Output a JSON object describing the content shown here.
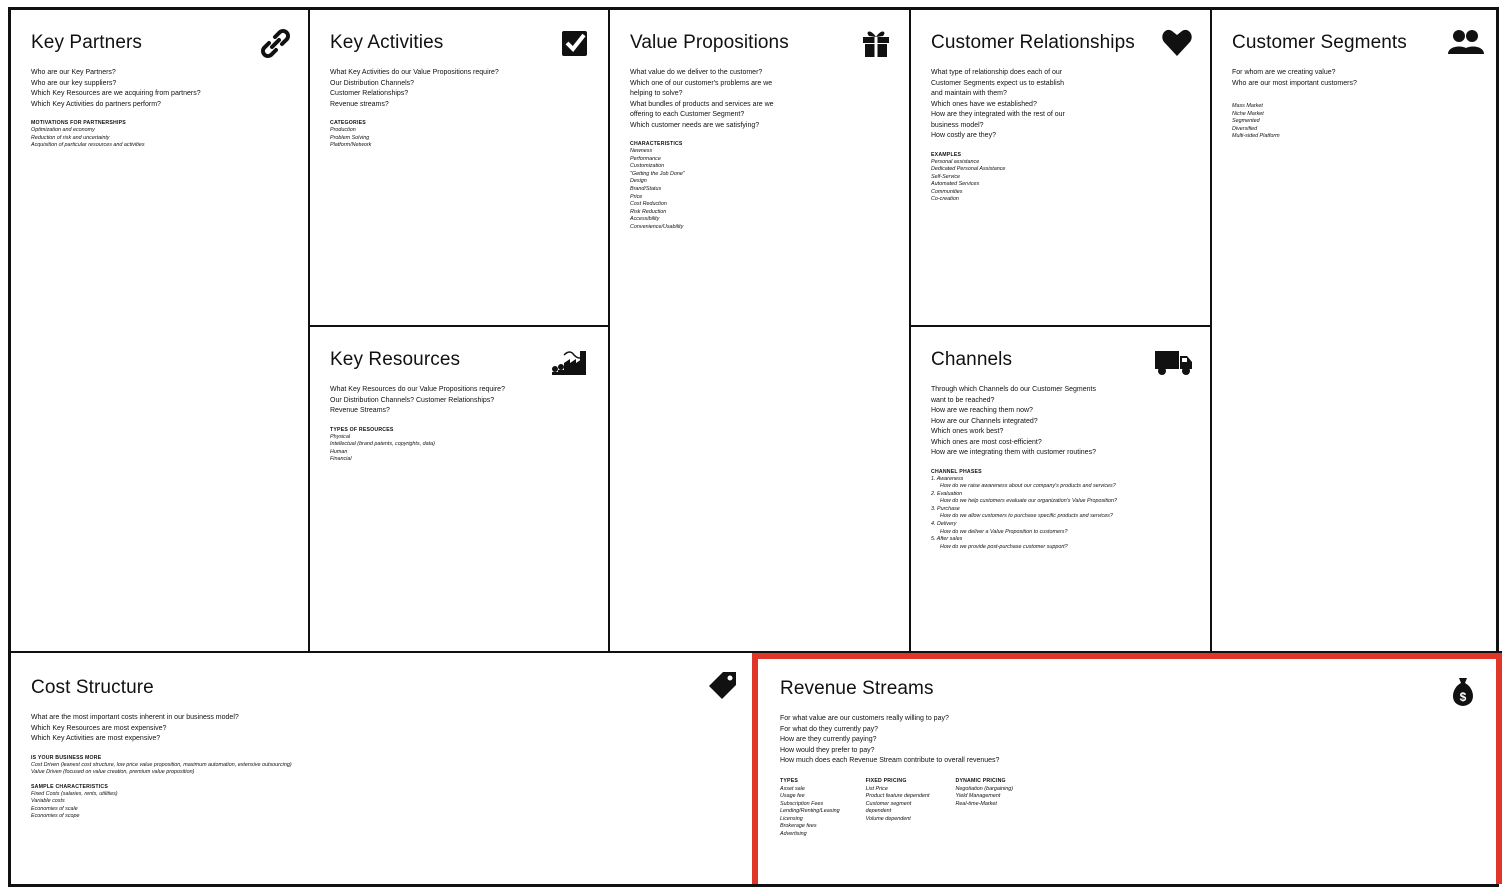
{
  "accent_color": "#e0362a",
  "cells": {
    "key_partners": {
      "title": "Key Partners",
      "icon": "link-icon",
      "questions": [
        "Who are our Key Partners?",
        "Who are our key suppliers?",
        "Which Key Resources are we acquiring from partners?",
        "Which Key Activities do partners perform?"
      ],
      "section_heading": "MOTIVATIONS FOR PARTNERSHIPS",
      "section_items": [
        "Optimization and economy",
        "Reduction of risk and uncertainty",
        "Acquisition of particular resources and activities"
      ]
    },
    "key_activities": {
      "title": "Key Activities",
      "icon": "checkbox-icon",
      "questions": [
        "What Key Activities do our Value Propositions require?",
        "Our Distribution Channels?",
        "Customer Relationships?",
        "Revenue streams?"
      ],
      "section_heading": "CATEGORIES",
      "section_items": [
        "Production",
        "Problem Solving",
        "Platform/Network"
      ]
    },
    "key_resources": {
      "title": "Key Resources",
      "icon": "factory-icon",
      "questions": [
        "What Key Resources do our Value Propositions require?",
        "Our Distribution Channels? Customer Relationships?",
        "Revenue Streams?"
      ],
      "section_heading": "TYPES OF RESOURCES",
      "section_items": [
        "Physical",
        "Intellectual (brand patents, copyrights, data)",
        "Human",
        "Financial"
      ]
    },
    "value_propositions": {
      "title": "Value Propositions",
      "icon": "gift-icon",
      "questions": [
        "What value do we deliver to the customer?",
        "Which one of our customer's problems are we",
        "helping to solve?",
        "What bundles of products and services are we",
        "offering to each Customer Segment?",
        "Which customer needs are we satisfying?"
      ],
      "section_heading": "CHARACTERISTICS",
      "section_items": [
        "Newness",
        "Performance",
        "Customization",
        "\"Getting the Job Done\"",
        "Design",
        "Brand/Status",
        "Price",
        "Cost Reduction",
        "Risk Reduction",
        "Accessibility",
        "Convenience/Usability"
      ]
    },
    "customer_relationships": {
      "title": "Customer Relationships",
      "icon": "heart-icon",
      "questions": [
        "What type of relationship does each of our",
        "Customer Segments expect us to establish",
        "and maintain with them?",
        "Which ones have we established?",
        "How are they integrated with the rest of our",
        "business model?",
        "How costly are they?"
      ],
      "section_heading": "EXAMPLES",
      "section_items": [
        "Personal assistance",
        "Dedicated Personal Assistance",
        "Self-Service",
        "Automated Services",
        "Communities",
        "Co-creation"
      ]
    },
    "channels": {
      "title": "Channels",
      "icon": "truck-icon",
      "questions": [
        "Through which Channels do our Customer Segments",
        "want to be reached?",
        "How are we reaching them now?",
        "How are our Channels integrated?",
        "Which ones work best?",
        "Which ones are most cost-efficient?",
        "How are we integrating them with customer routines?"
      ],
      "section_heading": "CHANNEL PHASES",
      "phases": [
        {
          "name": "1. Awareness",
          "q": "How do we raise awareness about our company's products and services?"
        },
        {
          "name": "2. Evaluation",
          "q": "How do we help customers evaluate our organization's Value Proposition?"
        },
        {
          "name": "3. Purchase",
          "q": "How do we allow customers to purchase specific products and services?"
        },
        {
          "name": "4. Delivery",
          "q": "How do we deliver a Value Proposition to customers?"
        },
        {
          "name": "5. After sales",
          "q": "How do we provide post-purchase customer support?"
        }
      ]
    },
    "customer_segments": {
      "title": "Customer Segments",
      "icon": "users-icon",
      "questions": [
        "For whom are we creating value?",
        "Who are our most important customers?"
      ],
      "section_items": [
        "Mass Market",
        "Niche Market",
        "Segmented",
        "Diversified",
        "Multi-sided Platform"
      ]
    },
    "cost_structure": {
      "title": "Cost Structure",
      "icon": "tag-icon",
      "questions": [
        "What are the most important costs inherent in our business model?",
        "Which Key Resources are most expensive?",
        "Which Key Activities are most expensive?"
      ],
      "section1_heading": "IS YOUR BUSINESS MORE",
      "section1_items": [
        "Cost Driven (leanest cost structure, low price value proposition, maximum automation, extensive outsourcing)",
        "Value Driven (focused on value creation, premium value proposition)"
      ],
      "section2_heading": "SAMPLE CHARACTERISTICS",
      "section2_items": [
        "Fixed Costs (salaries, rents, utilities)",
        "Variable costs",
        "Economies of scale",
        "Economies of scope"
      ]
    },
    "revenue_streams": {
      "title": "Revenue Streams",
      "icon": "money-bag-icon",
      "questions": [
        "For what value are our customers really willing to pay?",
        "For what do they currently pay?",
        "How are they currently paying?",
        "How would they prefer to pay?",
        "How much does each Revenue Stream contribute to overall revenues?"
      ],
      "columns": [
        {
          "heading": "TYPES",
          "items": [
            "Asset sale",
            "Usage fee",
            "Subscription Fees",
            "Lending/Renting/Leasing",
            "Licensing",
            "Brokerage fees",
            "Advertising"
          ]
        },
        {
          "heading": "FIXED PRICING",
          "items": [
            "List Price",
            "Product feature dependent",
            "Customer segment",
            "dependent",
            "Volume dependent"
          ]
        },
        {
          "heading": "DYNAMIC PRICING",
          "items": [
            "Negotiation (bargaining)",
            "Yield Management",
            "Real-time-Market"
          ]
        }
      ]
    }
  }
}
